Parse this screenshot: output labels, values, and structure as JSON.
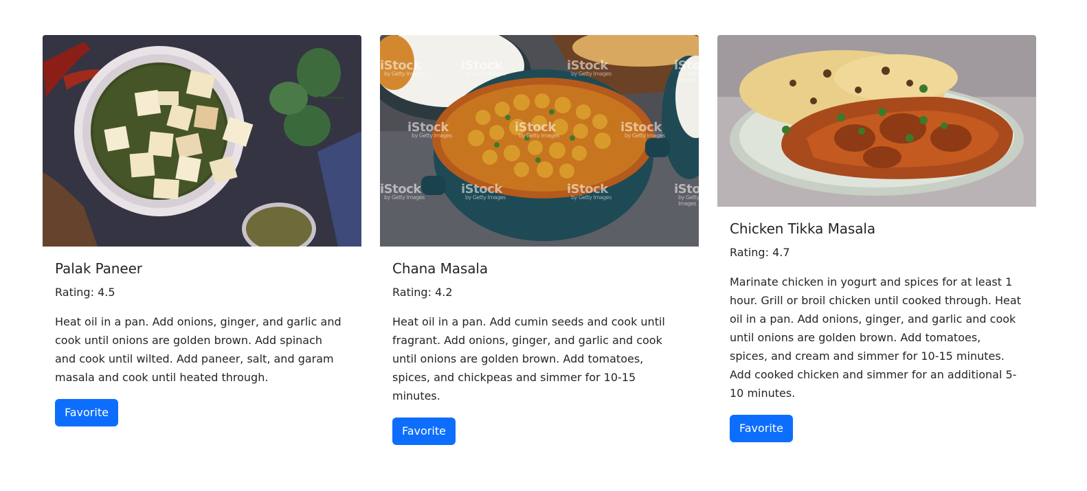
{
  "cards": [
    {
      "title": "Palak Paneer",
      "rating": "Rating: 4.5",
      "instructions": "Heat oil in a pan. Add onions, ginger, and garlic and cook until onions are golden brown. Add spinach and cook until wilted. Add paneer, salt, and garam masala and cook until heated through.",
      "button_label": "Favorite"
    },
    {
      "title": "Chana Masala",
      "rating": "Rating: 4.2",
      "instructions": "Heat oil in a pan. Add cumin seeds and cook until fragrant. Add onions, ginger, and garlic and cook until onions are golden brown. Add tomatoes, spices, and chickpeas and simmer for 10-15 minutes.",
      "button_label": "Favorite",
      "watermark": "iStock",
      "watermark_sub": "by Getty Images"
    },
    {
      "title": "Chicken Tikka Masala",
      "rating": "Rating: 4.7",
      "instructions": "Marinate chicken in yogurt and spices for at least 1 hour. Grill or broil chicken until cooked through. Heat oil in a pan. Add onions, ginger, and garlic and cook until onions are golden brown. Add tomatoes, spices, and cream and simmer for 10-15 minutes. Add cooked chicken and simmer for an additional 5-10 minutes.",
      "button_label": "Favorite"
    }
  ],
  "colors": {
    "button_bg": "#0d6efd",
    "button_text": "#ffffff",
    "text": "#212529"
  }
}
